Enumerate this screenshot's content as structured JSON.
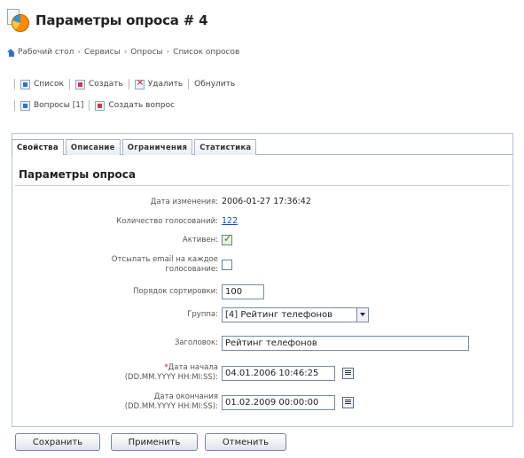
{
  "header": {
    "title": "Параметры опроса # 4"
  },
  "breadcrumb": [
    "Рабочий стол",
    "Сервисы",
    "Опросы",
    "Список опросов"
  ],
  "toolbar_main": [
    {
      "label": "Список",
      "icon": "list-icon"
    },
    {
      "label": "Создать",
      "icon": "new-icon"
    },
    {
      "label": "Удалить",
      "icon": "delete-icon"
    },
    {
      "label": "Обнулить",
      "icon": ""
    }
  ],
  "toolbar_questions": [
    {
      "label": "Вопросы [1]",
      "icon": "questions-icon"
    },
    {
      "label": "Создать вопрос",
      "icon": "new-question-icon"
    }
  ],
  "tabs": [
    "Свойства",
    "Описание",
    "Ограничения",
    "Статистика"
  ],
  "section": {
    "title": "Параметры опроса"
  },
  "form": {
    "date_changed": {
      "label": "Дата изменения:",
      "value": "2006-01-27 17:36:42"
    },
    "votes_count": {
      "label": "Количество голосований:",
      "value": "122"
    },
    "active": {
      "label": "Активен:",
      "checked": true
    },
    "send_email": {
      "label_line1": "Отсылать email на каждое",
      "label_line2": "голосование:",
      "checked": false
    },
    "sort_order": {
      "label": "Порядок сортировки:",
      "value": "100"
    },
    "group": {
      "label": "Группа:",
      "value": "[4] Рейтинг телефонов"
    },
    "heading": {
      "label": "Заголовок:",
      "value": "Рейтинг телефонов"
    },
    "date_start": {
      "required_mark": "*",
      "label_line1": "Дата начала",
      "label_line2": "(DD.MM.YYYY HH:MI:SS):",
      "value": "04.01.2006 10:46:25"
    },
    "date_end": {
      "label_line1": "Дата окончания",
      "label_line2": "(DD.MM.YYYY HH:MI:SS):",
      "value": "01.02.2009 00:00:00"
    }
  },
  "buttons": {
    "save": "Сохранить",
    "apply": "Применить",
    "cancel": "Отменить"
  }
}
